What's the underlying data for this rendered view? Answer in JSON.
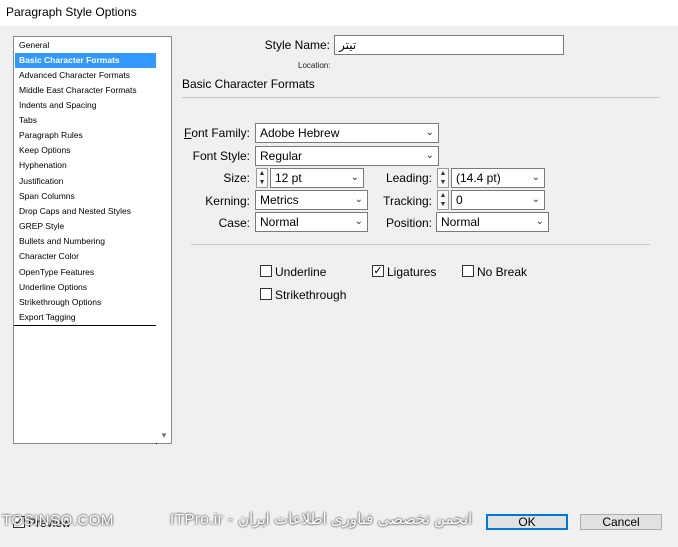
{
  "window": {
    "title": "Paragraph Style Options"
  },
  "categories": [
    "General",
    "Basic Character Formats",
    "Advanced Character Formats",
    "Middle East Character Formats",
    "Indents and Spacing",
    "Tabs",
    "Paragraph Rules",
    "Keep Options",
    "Hyphenation",
    "Justification",
    "Span Columns",
    "Drop Caps and Nested Styles",
    "GREP Style",
    "Bullets and Numbering",
    "Character Color",
    "OpenType Features",
    "Underline Options",
    "Strikethrough Options",
    "Export Tagging"
  ],
  "selected_category": "Basic Character Formats",
  "style_name": {
    "label": "Style Name:",
    "value": "تیتر"
  },
  "location": {
    "label": "Location:"
  },
  "section_title": "Basic Character Formats",
  "fields": {
    "font_family": {
      "label": "Font Family:",
      "value": "Adobe Hebrew"
    },
    "font_style": {
      "label": "Font Style:",
      "value": "Regular"
    },
    "size": {
      "label": "Size:",
      "value": "12 pt"
    },
    "leading": {
      "label": "Leading:",
      "value": "(14.4 pt)"
    },
    "kerning": {
      "label": "Kerning:",
      "value": "Metrics"
    },
    "tracking": {
      "label": "Tracking:",
      "value": "0"
    },
    "case": {
      "label": "Case:",
      "value": "Normal"
    },
    "position": {
      "label": "Position:",
      "value": "Normal"
    }
  },
  "checkboxes": {
    "underline": {
      "label": "Underline",
      "checked": false
    },
    "ligatures": {
      "label": "Ligatures",
      "checked": true
    },
    "no_break": {
      "label": "No Break",
      "checked": false
    },
    "strikethrough": {
      "label": "Strikethrough",
      "checked": false
    }
  },
  "preview": {
    "label": "Preview",
    "checked": true
  },
  "buttons": {
    "ok": "OK",
    "cancel": "Cancel"
  },
  "watermark": {
    "left": "TOSINSO.COM",
    "right": "ITPro.ir - انجمن تخصصی فناوری اطلاعات ایران"
  }
}
